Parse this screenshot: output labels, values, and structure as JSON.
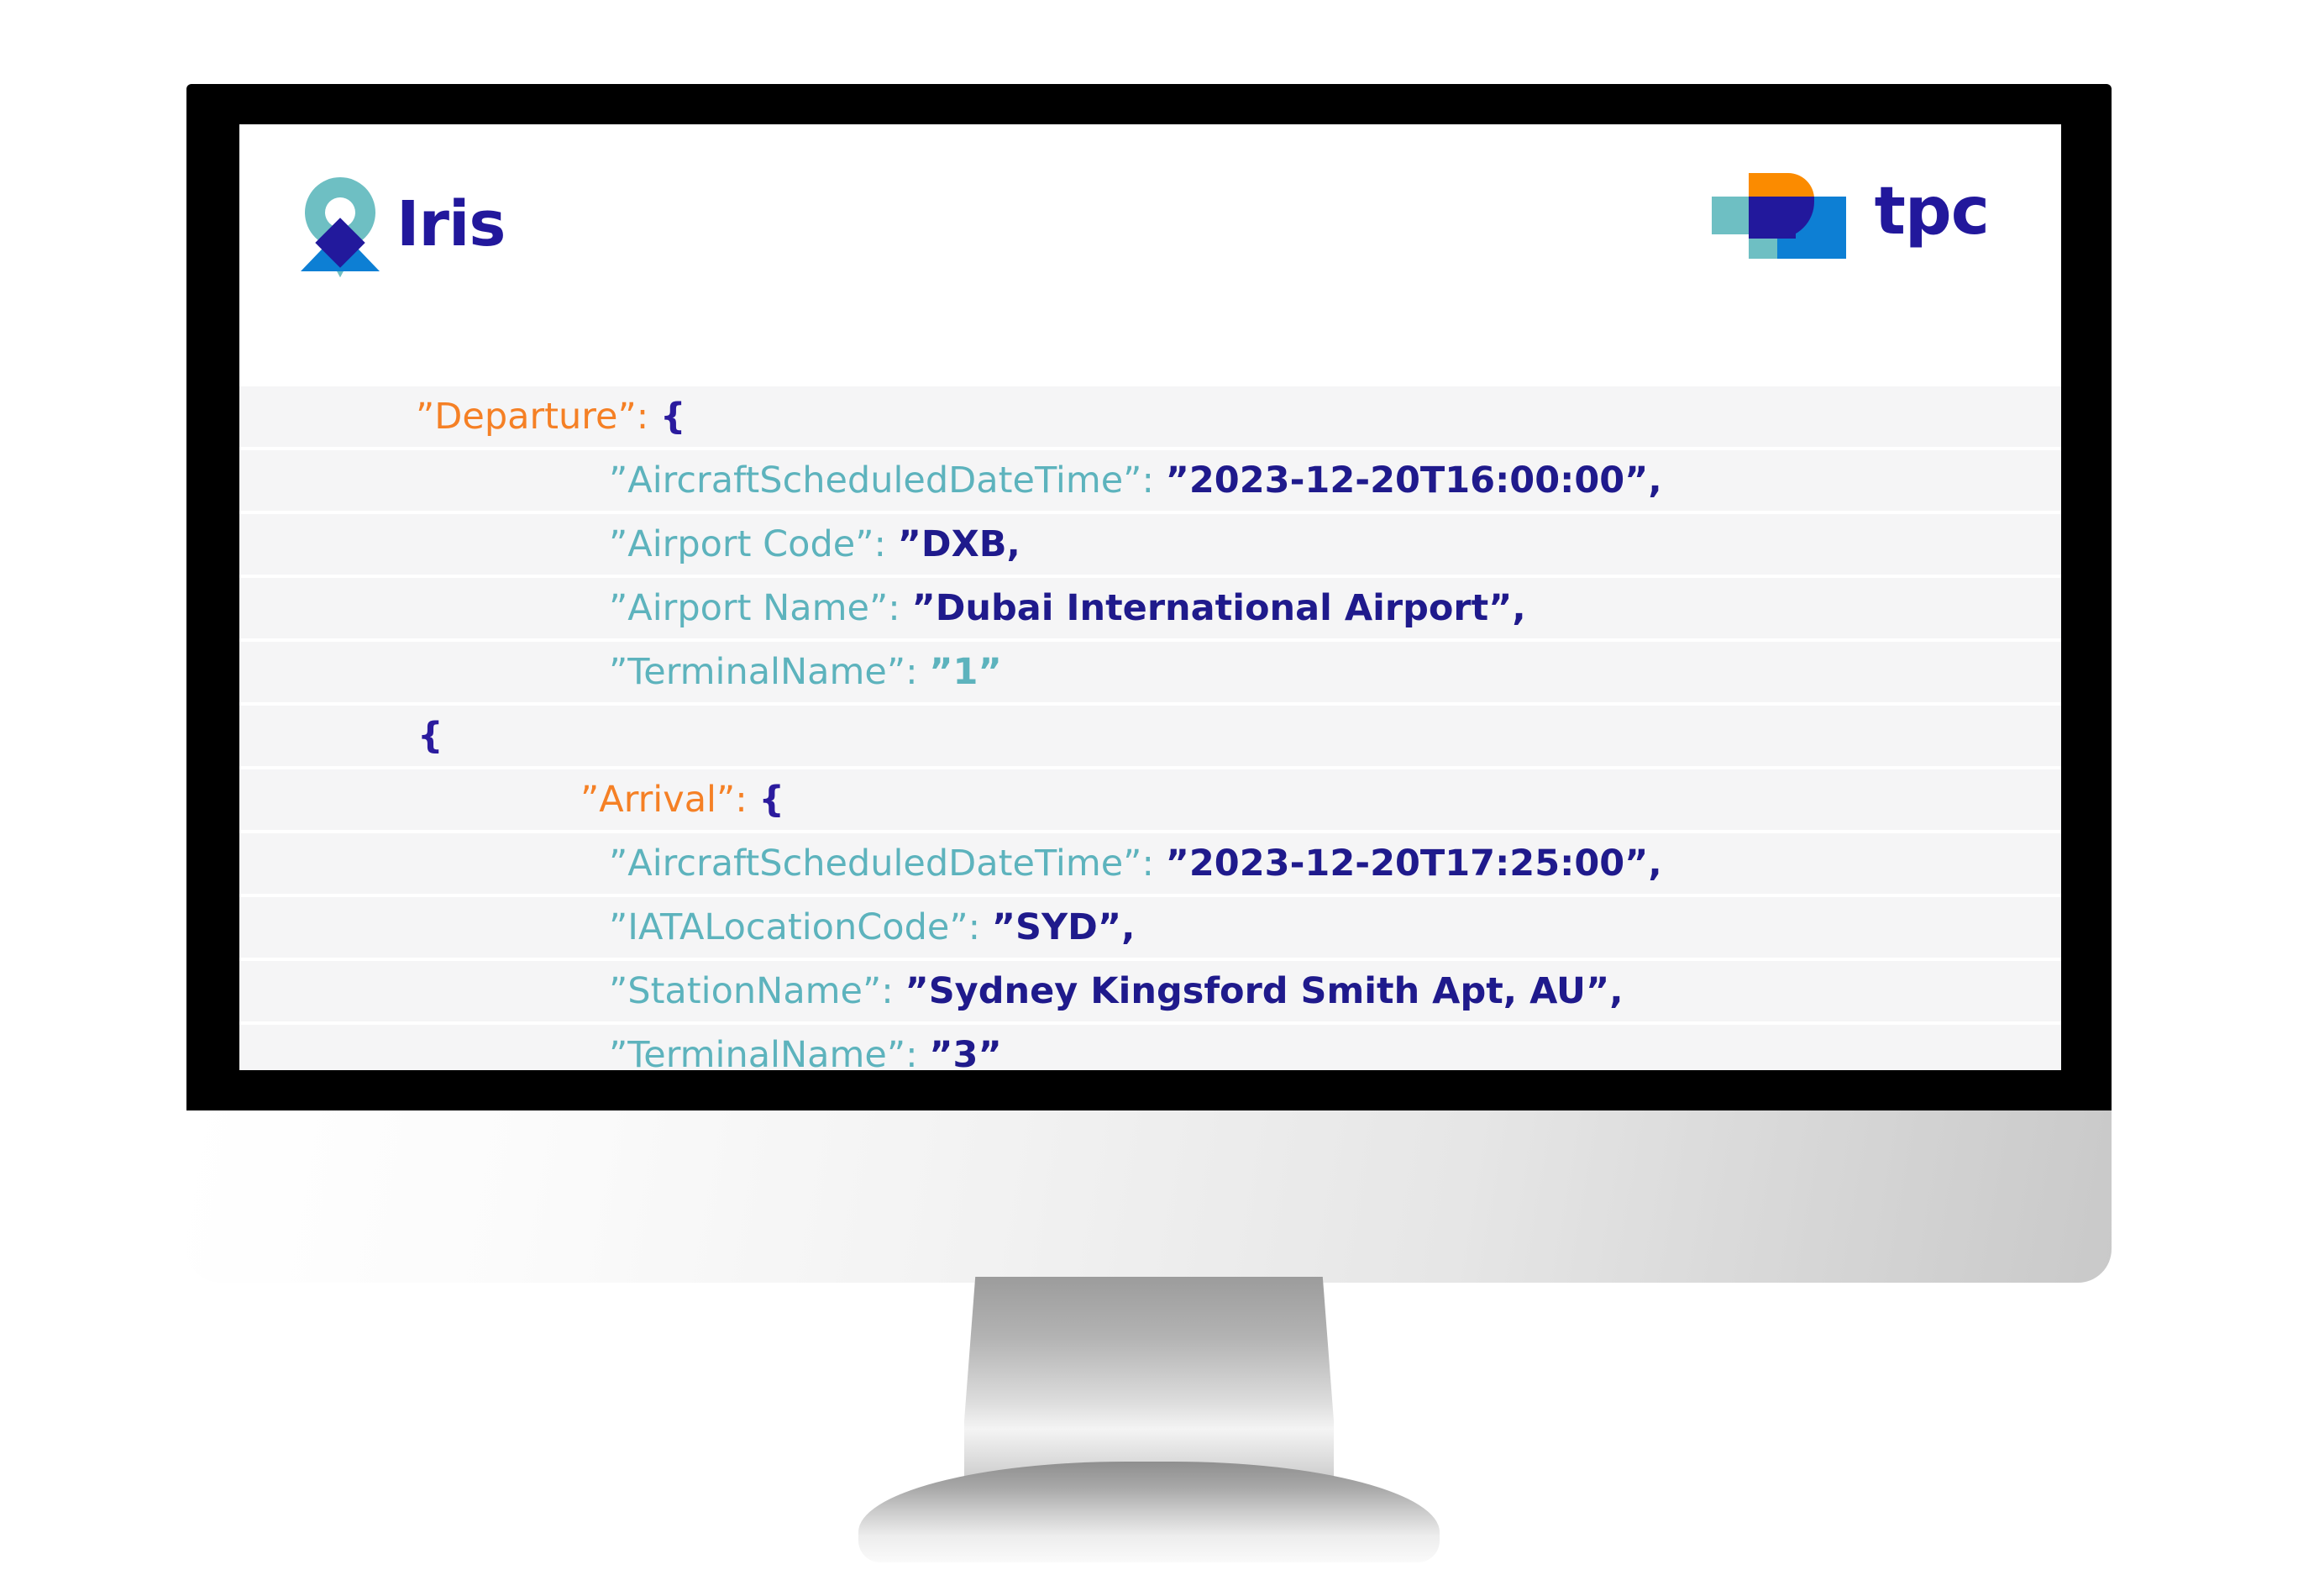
{
  "colors": {
    "key_teal": "#5db3bd",
    "object_orange": "#f58025",
    "value_navy": "#1f1a8c",
    "brace_navy": "#2b1b9e",
    "row_bg": "#f5f5f6",
    "screen_bg": "#ffffff",
    "bezel_black": "#000000",
    "brand_navy": "#22189c",
    "brand_teal": "#6ebfc3",
    "brand_blue": "#0d7fd4",
    "brand_orange": "#fb8b00"
  },
  "brand": {
    "iris_name": "Iris",
    "iris_icon": "location-pin-mountain-icon",
    "tpc_name": "tpc",
    "tpc_icon": "tpc-squares-icon"
  },
  "code": {
    "lines": [
      {
        "id": "departure-open",
        "indent": 210,
        "parts": [
          {
            "t": "obj",
            "s": "”Departure”:"
          },
          {
            "t": "space",
            "s": " "
          },
          {
            "t": "brace",
            "s": "{"
          }
        ]
      },
      {
        "id": "dep-scheduled-datetime",
        "indent": 440,
        "parts": [
          {
            "t": "key",
            "s": "”AircraftScheduledDateTime”:"
          },
          {
            "t": "space",
            "s": " "
          },
          {
            "t": "val",
            "s": "”2023-12-20T16:00:00”,"
          }
        ]
      },
      {
        "id": "dep-airport-code",
        "indent": 440,
        "parts": [
          {
            "t": "key",
            "s": "”Airport Code”:"
          },
          {
            "t": "space",
            "s": " "
          },
          {
            "t": "val",
            "s": "”DXB,"
          }
        ]
      },
      {
        "id": "dep-airport-name",
        "indent": 440,
        "parts": [
          {
            "t": "key",
            "s": "”Airport Name”:"
          },
          {
            "t": "space",
            "s": " "
          },
          {
            "t": "val",
            "s": "”Dubai International Airport”,"
          }
        ]
      },
      {
        "id": "dep-terminal-name",
        "indent": 440,
        "parts": [
          {
            "t": "key",
            "s": "”TerminalName”:"
          },
          {
            "t": "space",
            "s": " "
          },
          {
            "t": "valk",
            "s": "”1”"
          }
        ]
      },
      {
        "id": "object-open-brace",
        "indent": 212,
        "parts": [
          {
            "t": "brace",
            "s": "{"
          }
        ]
      },
      {
        "id": "arrival-open",
        "indent": 406,
        "parts": [
          {
            "t": "obj",
            "s": "”Arrival”:"
          },
          {
            "t": "space",
            "s": " "
          },
          {
            "t": "brace",
            "s": "{"
          }
        ]
      },
      {
        "id": "arr-scheduled-datetime",
        "indent": 440,
        "parts": [
          {
            "t": "key",
            "s": "”AircraftScheduledDateTime”:"
          },
          {
            "t": "space",
            "s": " "
          },
          {
            "t": "val",
            "s": "”2023-12-20T17:25:00”,"
          }
        ]
      },
      {
        "id": "arr-iata-location-code",
        "indent": 440,
        "parts": [
          {
            "t": "key",
            "s": "”IATALocationCode”:"
          },
          {
            "t": "space",
            "s": " "
          },
          {
            "t": "val",
            "s": "”SYD”,"
          }
        ]
      },
      {
        "id": "arr-station-name",
        "indent": 440,
        "parts": [
          {
            "t": "key",
            "s": "”StationName”:"
          },
          {
            "t": "space",
            "s": " "
          },
          {
            "t": "val",
            "s": "”Sydney Kingsford Smith Apt, AU”,"
          }
        ]
      },
      {
        "id": "arr-terminal-name",
        "indent": 440,
        "parts": [
          {
            "t": "key",
            "s": "”TerminalName”:"
          },
          {
            "t": "space",
            "s": " "
          },
          {
            "t": "val",
            "s": "”3”"
          }
        ]
      }
    ]
  }
}
